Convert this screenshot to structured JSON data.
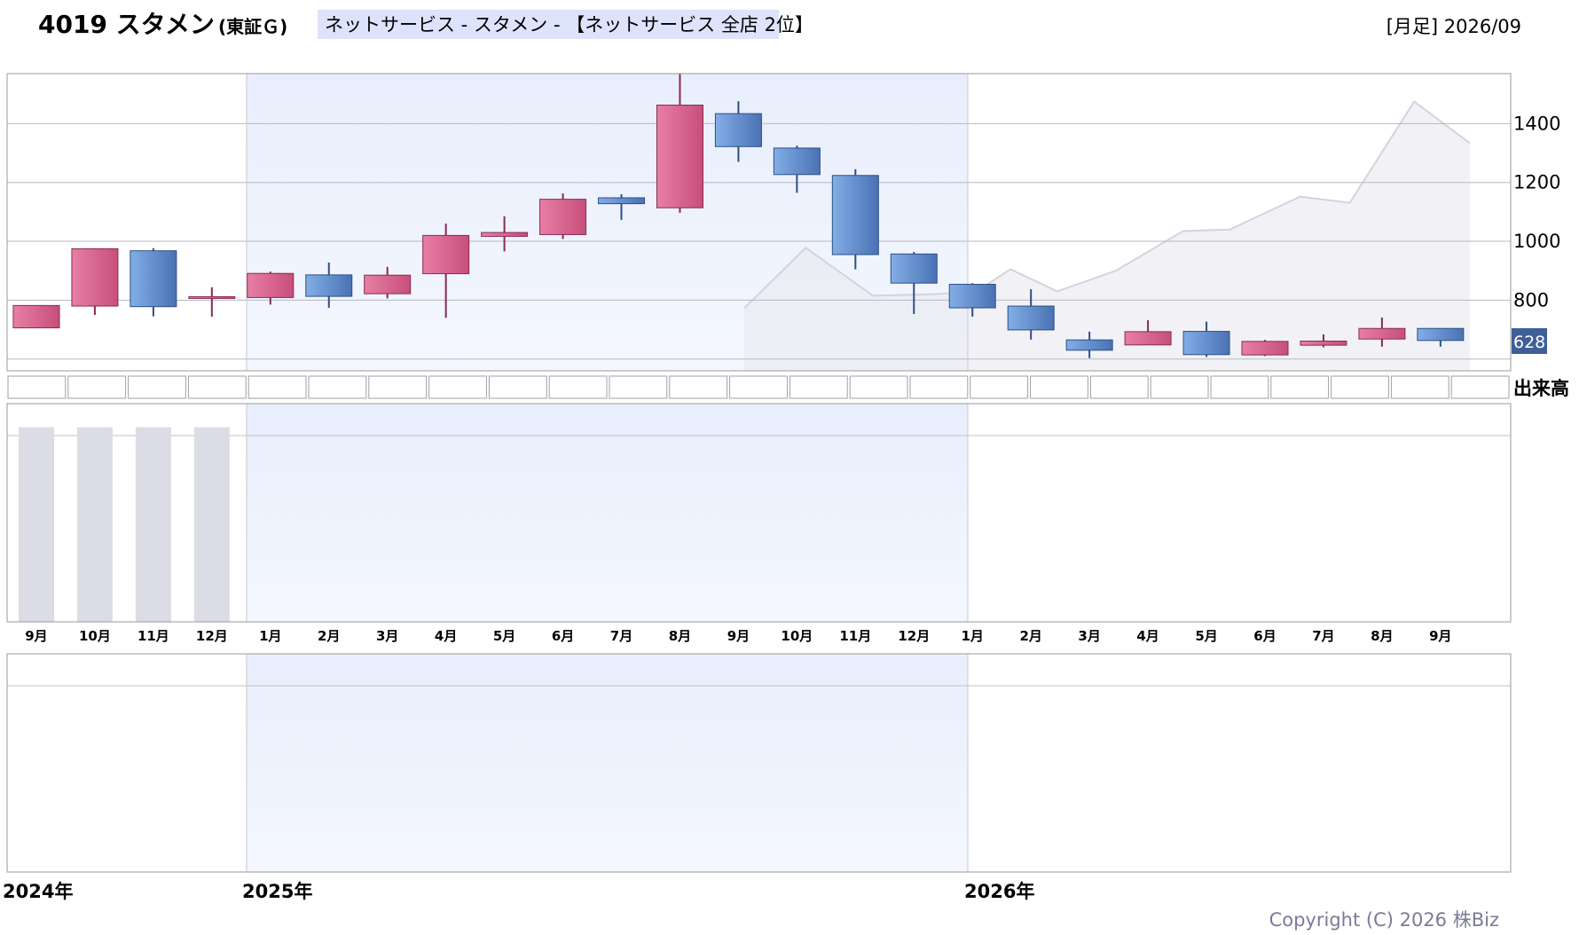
{
  "header": {
    "code_name": "4019 スタメン",
    "exchange": "(東証Ｇ)",
    "industry": "ネットサービス - スタメン - 【ネットサービス 全店 2位】",
    "period": "[月足] 2026/09"
  },
  "price_axis": {
    "ticks": [
      800,
      1000,
      1200,
      1400
    ],
    "last_price": "628"
  },
  "volume_label": "出来高",
  "years": [
    "2024年",
    "2025年",
    "2026年"
  ],
  "copyright": "Copyright (C) 2026 株Biz",
  "colors": {
    "up": "#d9658f",
    "down": "#5b86c8",
    "highlight": "#eaf0fc",
    "volume_bar": "#dcdce6",
    "comparison_area": "#e8e8ee"
  },
  "chart_data": {
    "type": "candlestick",
    "ylim": [
      560,
      1570
    ],
    "categories": [
      "9月",
      "10月",
      "11月",
      "12月",
      "1月",
      "2月",
      "3月",
      "4月",
      "5月",
      "6月",
      "7月",
      "8月",
      "9月",
      "10月",
      "11月",
      "12月",
      "1月",
      "2月",
      "3月",
      "4月",
      "5月",
      "6月",
      "7月",
      "8月",
      "9月"
    ],
    "ohlc": [
      {
        "o": 706,
        "h": 782,
        "l": 706,
        "c": 782,
        "dir": "up"
      },
      {
        "o": 780,
        "h": 975,
        "l": 750,
        "c": 975,
        "dir": "up"
      },
      {
        "o": 968,
        "h": 977,
        "l": 745,
        "c": 778,
        "dir": "down"
      },
      {
        "o": 807,
        "h": 844,
        "l": 744,
        "c": 812,
        "dir": "up"
      },
      {
        "o": 809,
        "h": 897,
        "l": 785,
        "c": 891,
        "dir": "up"
      },
      {
        "o": 886,
        "h": 928,
        "l": 774,
        "c": 813,
        "dir": "down"
      },
      {
        "o": 822,
        "h": 913,
        "l": 806,
        "c": 885,
        "dir": "up"
      },
      {
        "o": 890,
        "h": 1060,
        "l": 740,
        "c": 1020,
        "dir": "up"
      },
      {
        "o": 1017,
        "h": 1085,
        "l": 966,
        "c": 1030,
        "dir": "up"
      },
      {
        "o": 1023,
        "h": 1163,
        "l": 1008,
        "c": 1143,
        "dir": "up"
      },
      {
        "o": 1148,
        "h": 1160,
        "l": 1073,
        "c": 1128,
        "dir": "down"
      },
      {
        "o": 1114,
        "h": 1570,
        "l": 1097,
        "c": 1463,
        "dir": "up"
      },
      {
        "o": 1434,
        "h": 1476,
        "l": 1270,
        "c": 1322,
        "dir": "down"
      },
      {
        "o": 1317,
        "h": 1325,
        "l": 1165,
        "c": 1227,
        "dir": "down"
      },
      {
        "o": 1224,
        "h": 1245,
        "l": 905,
        "c": 955,
        "dir": "down"
      },
      {
        "o": 957,
        "h": 964,
        "l": 753,
        "c": 858,
        "dir": "down"
      },
      {
        "o": 854,
        "h": 858,
        "l": 744,
        "c": 774,
        "dir": "down"
      },
      {
        "o": 780,
        "h": 837,
        "l": 666,
        "c": 699,
        "dir": "down"
      },
      {
        "o": 665,
        "h": 693,
        "l": 603,
        "c": 630,
        "dir": "down"
      },
      {
        "o": 648,
        "h": 732,
        "l": 649,
        "c": 693,
        "dir": "up"
      },
      {
        "o": 694,
        "h": 727,
        "l": 607,
        "c": 615,
        "dir": "down"
      },
      {
        "o": 614,
        "h": 665,
        "l": 610,
        "c": 660,
        "dir": "up"
      },
      {
        "o": 647,
        "h": 684,
        "l": 640,
        "c": 661,
        "dir": "up"
      },
      {
        "o": 668,
        "h": 741,
        "l": 642,
        "c": 704,
        "dir": "up"
      },
      {
        "o": 704,
        "h": 704,
        "l": 642,
        "c": 663,
        "dir": "down"
      }
    ],
    "comparison_series": [
      {
        "i": 12.6,
        "v": 773
      },
      {
        "i": 13.65,
        "v": 978
      },
      {
        "i": 14.8,
        "v": 815
      },
      {
        "i": 15.75,
        "v": 820
      },
      {
        "i": 16.55,
        "v": 827
      },
      {
        "i": 17.15,
        "v": 905
      },
      {
        "i": 17.95,
        "v": 830
      },
      {
        "i": 18.95,
        "v": 900
      },
      {
        "i": 20.1,
        "v": 1035
      },
      {
        "i": 20.9,
        "v": 1040
      },
      {
        "i": 22.1,
        "v": 1152
      },
      {
        "i": 22.95,
        "v": 1131
      },
      {
        "i": 24.05,
        "v": 1475
      },
      {
        "i": 25.0,
        "v": 1334
      }
    ],
    "volume": [
      0.95,
      0.95,
      0.95,
      0.95
    ]
  }
}
